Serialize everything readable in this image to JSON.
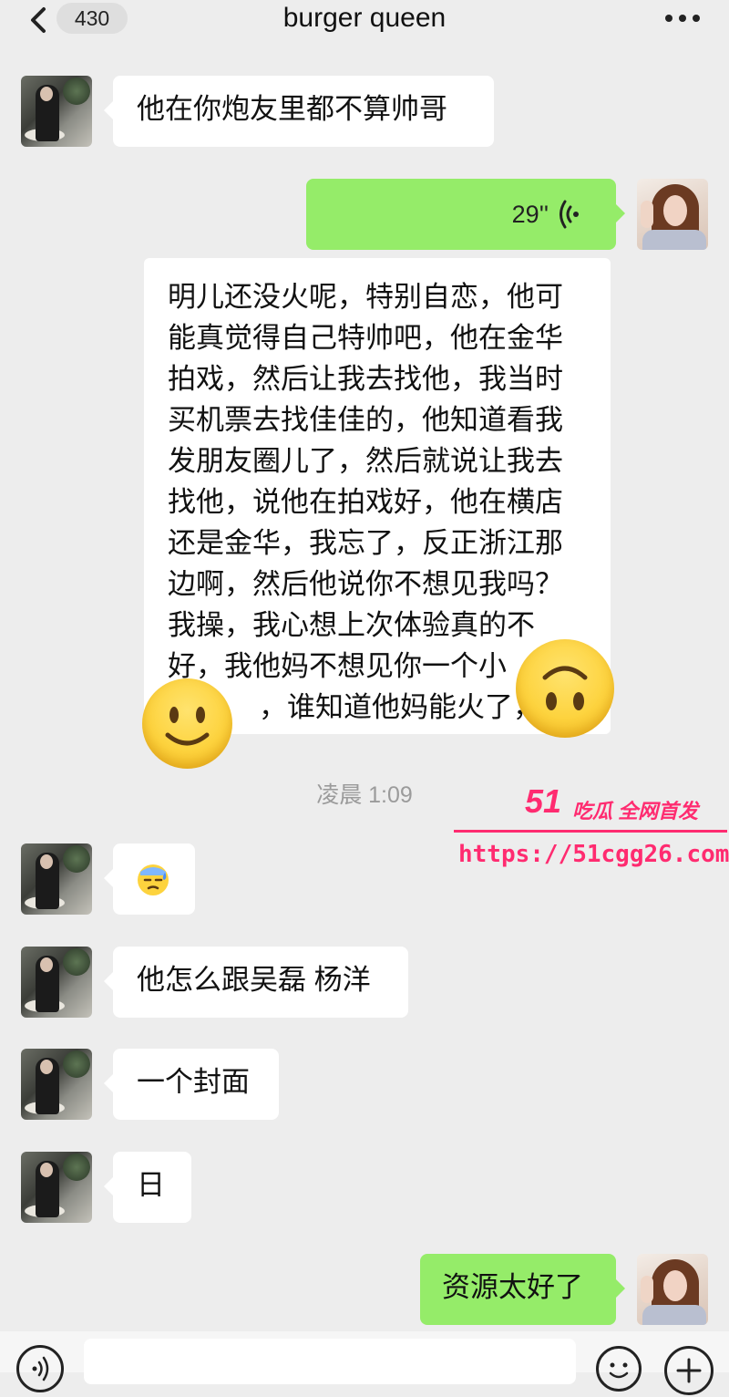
{
  "header": {
    "back_icon": "chevron-left-icon",
    "unread_count": "430",
    "title": "burger queen",
    "more_icon": "more-horizontal-icon"
  },
  "messages": [
    {
      "sender": "other",
      "type": "text",
      "text": "他在你炮友里都不算帅哥"
    },
    {
      "sender": "self",
      "type": "voice",
      "duration": "29''",
      "icon": "voice-wave-icon"
    },
    {
      "sender": "shared",
      "type": "text",
      "lines": [
        "明儿还没火呢，特别自恋，他可",
        "能真觉得自己特帅吧，他在金华",
        "拍戏，然后让我去找他，我当时",
        "买机票去找佳佳的，他知道看我",
        "发朋友圈儿了，然后就说让我去",
        "找他，说他在拍戏好，他在横店",
        "还是金华，我忘了，反正浙江那",
        "边啊，然后他说你不想见我吗？",
        "我操，我心想上次体验真的不",
        "好，我他妈不想见你一个小",
        "，谁知道他妈能火了，"
      ]
    },
    {
      "sender": "other",
      "type": "emoji",
      "icon": "sweat-emoji-icon"
    },
    {
      "sender": "other",
      "type": "text",
      "text": "他怎么跟吴磊 杨洋"
    },
    {
      "sender": "other",
      "type": "text",
      "text": "一个封面"
    },
    {
      "sender": "other",
      "type": "text",
      "text": "日"
    },
    {
      "sender": "self",
      "type": "text",
      "text": "资源太好了"
    }
  ],
  "timestamp": "凌晨 1:09",
  "watermark": {
    "logo": "51",
    "tagline": "吃瓜 全网首发",
    "url": "https://51cgg26.com"
  },
  "input_bar": {
    "voice_icon": "voice-input-icon",
    "emoji_icon": "emoji-face-icon",
    "plus_icon": "plus-icon"
  },
  "colors": {
    "background": "#ededed",
    "bubble_self": "#95ec69",
    "bubble_other": "#ffffff",
    "watermark": "#ff2b70"
  }
}
